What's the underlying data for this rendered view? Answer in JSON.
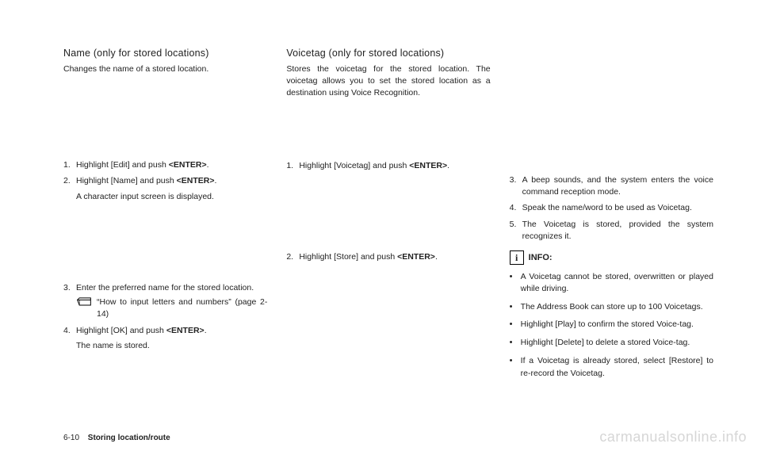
{
  "col1": {
    "heading": "Name (only for stored locations)",
    "intro": "Changes the name of a stored location.",
    "steps_a": [
      {
        "n": "1.",
        "t": "Highlight [Edit] and push ",
        "btn": "<ENTER>",
        "tail": "."
      },
      {
        "n": "2.",
        "t": "Highlight [Name] and push ",
        "btn": "<ENTER>",
        "tail": ".",
        "sub": "A character input screen is displayed."
      }
    ],
    "steps_b": [
      {
        "n": "3.",
        "t": "Enter the preferred name for the stored location.",
        "ref": "“How to input letters and numbers” (page 2-14)"
      },
      {
        "n": "4.",
        "t": "Highlight [OK] and push ",
        "btn": "<ENTER>",
        "tail": ".",
        "sub": "The name is stored."
      }
    ]
  },
  "col2": {
    "heading": "Voicetag (only for stored locations)",
    "intro": "Stores the voicetag for the stored location. The voicetag allows you to set the stored location as a destination using Voice Recognition.",
    "steps_a": [
      {
        "n": "1.",
        "t": "Highlight [Voicetag] and push ",
        "btn": "<ENTER>",
        "tail": "."
      }
    ],
    "steps_b": [
      {
        "n": "2.",
        "t": "Highlight [Store] and push ",
        "btn": "<ENTER>",
        "tail": "."
      }
    ]
  },
  "col3": {
    "steps": [
      {
        "n": "3.",
        "t": "A beep sounds, and the system enters the voice command reception mode."
      },
      {
        "n": "4.",
        "t": "Speak the name/word to be used as Voicetag."
      },
      {
        "n": "5.",
        "t": "The Voicetag is stored, provided the system recognizes it."
      }
    ],
    "info_label": "INFO:",
    "bullets": [
      "A Voicetag cannot be stored, overwritten or played while driving.",
      "The Address Book can store up to 100 Voicetags.",
      "Highlight [Play] to confirm the stored Voice-tag.",
      "Highlight [Delete] to delete a stored Voice-tag.",
      "If a Voicetag is already stored, select [Restore] to re-record the Voicetag."
    ]
  },
  "footer": {
    "page": "6-10",
    "section": "Storing location/route"
  },
  "watermark": "carmanualsonline.info"
}
